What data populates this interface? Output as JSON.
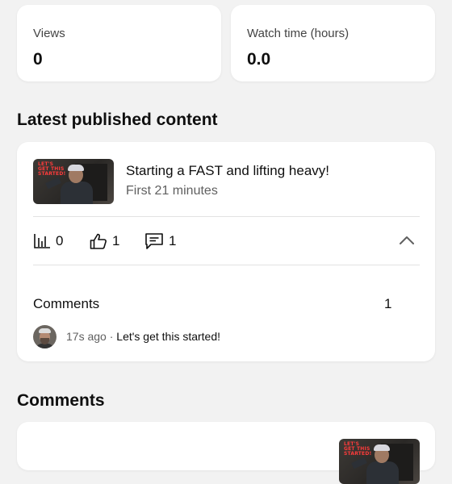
{
  "stats": {
    "views": {
      "label": "Views",
      "value": "0"
    },
    "watch_time": {
      "label": "Watch time (hours)",
      "value": "0.0"
    }
  },
  "latest": {
    "heading": "Latest published content",
    "video": {
      "thumbnail_text": "LET'S GET THIS STARTED!",
      "title": "Starting a FAST and lifting heavy!",
      "subtitle": "First 21 minutes"
    },
    "metrics": {
      "views": "0",
      "likes": "1",
      "comments": "1"
    },
    "comments_label": "Comments",
    "comments_count": "1",
    "recent_comment": {
      "time": "17s ago",
      "separator": " · ",
      "text": "Let's get this started!"
    }
  },
  "comments_section": {
    "heading": "Comments",
    "thumbnail_text": "LET'S GET THIS STARTED!"
  },
  "icons": {
    "analytics": "bar-chart-icon",
    "like": "thumbs-up-icon",
    "comment": "comment-icon",
    "collapse": "chevron-up-icon"
  }
}
